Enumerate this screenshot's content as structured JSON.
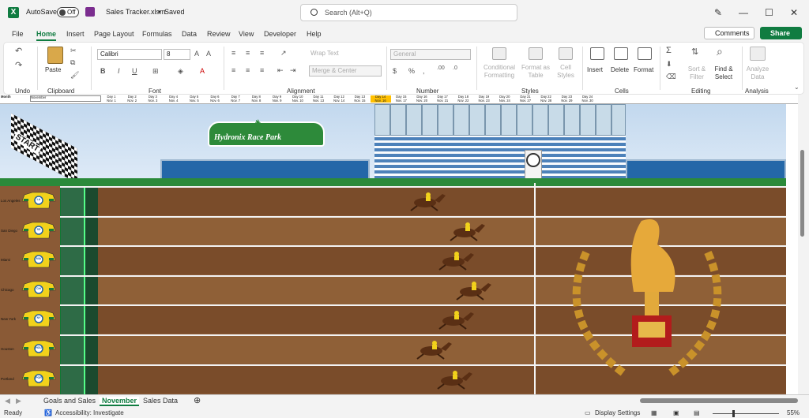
{
  "titlebar": {
    "autosave": "AutoSave",
    "toggle": "Off",
    "filename": "Sales Tracker.xlsm",
    "saved": "Saved",
    "search_placeholder": "Search (Alt+Q)"
  },
  "menu": [
    "File",
    "Home",
    "Insert",
    "Page Layout",
    "Formulas",
    "Data",
    "Review",
    "View",
    "Developer",
    "Help"
  ],
  "comments": "Comments",
  "share": "Share",
  "ribbon": {
    "undo": "Undo",
    "clipboard": "Clipboard",
    "paste": "Paste",
    "font": "Font",
    "font_name": "Calibri",
    "font_size": "8",
    "alignment": "Alignment",
    "wrap_text": "Wrap Text",
    "merge_center": "Merge & Center",
    "number": "Number",
    "number_format": "General",
    "styles": "Styles",
    "conditional_formatting": "Conditional Formatting",
    "format_as_table": "Format as Table",
    "cell_styles": "Cell Styles",
    "cells": "Cells",
    "insert": "Insert",
    "delete": "Delete",
    "format": "Format",
    "editing": "Editing",
    "sort_filter": "Sort & Filter",
    "find_select": "Find & Select",
    "analysis": "Analysis",
    "analyze_data": "Analyze Data"
  },
  "sheet": {
    "month_label": "Month",
    "month_value": "November",
    "days": [
      [
        "Day 1",
        "Nov. 1"
      ],
      [
        "Day 2",
        "Nov. 2"
      ],
      [
        "Day 3",
        "Nov. 3"
      ],
      [
        "Day 4",
        "Nov. 4"
      ],
      [
        "Day 5",
        "Nov. 5"
      ],
      [
        "Day 6",
        "Nov. 6"
      ],
      [
        "Day 7",
        "Nov. 7"
      ],
      [
        "Day 8",
        "Nov. 8"
      ],
      [
        "Day 9",
        "Nov. 9"
      ],
      [
        "Day 10",
        "Nov. 10"
      ],
      [
        "Day 11",
        "Nov. 13"
      ],
      [
        "Day 12",
        "Nov. 14"
      ],
      [
        "Day 13",
        "Nov. 15"
      ],
      [
        "Day 14",
        "Nov. 16"
      ],
      [
        "Day 15",
        "Nov. 17"
      ],
      [
        "Day 16",
        "Nov. 20"
      ],
      [
        "Day 17",
        "Nov. 21"
      ],
      [
        "Day 18",
        "Nov. 22"
      ],
      [
        "Day 19",
        "Nov. 23"
      ],
      [
        "Day 20",
        "Nov. 24"
      ],
      [
        "Day 21",
        "Nov. 27"
      ],
      [
        "Day 22",
        "Nov. 28"
      ],
      [
        "Day 23",
        "Nov. 29"
      ],
      [
        "Day 24",
        "Nov. 30"
      ]
    ],
    "highlight_day_index": 13,
    "park_name": "Hydronix Race Park",
    "start_text": "START",
    "lanes": [
      {
        "city": "Los Angeles",
        "badge": "LA"
      },
      {
        "city": "San Diego",
        "badge": "SD"
      },
      {
        "city": "Miami",
        "badge": "MIA"
      },
      {
        "city": "Chicago",
        "badge": "CHI"
      },
      {
        "city": "New York",
        "badge": "NY"
      },
      {
        "city": "Houston",
        "badge": "HOU"
      },
      {
        "city": "Portland",
        "badge": "POR"
      }
    ]
  },
  "tabs": [
    "Goals and Sales",
    "November",
    "Sales Data"
  ],
  "status": {
    "ready": "Ready",
    "accessibility": "Accessibility: Investigate",
    "display_settings": "Display Settings",
    "zoom": "55%"
  }
}
